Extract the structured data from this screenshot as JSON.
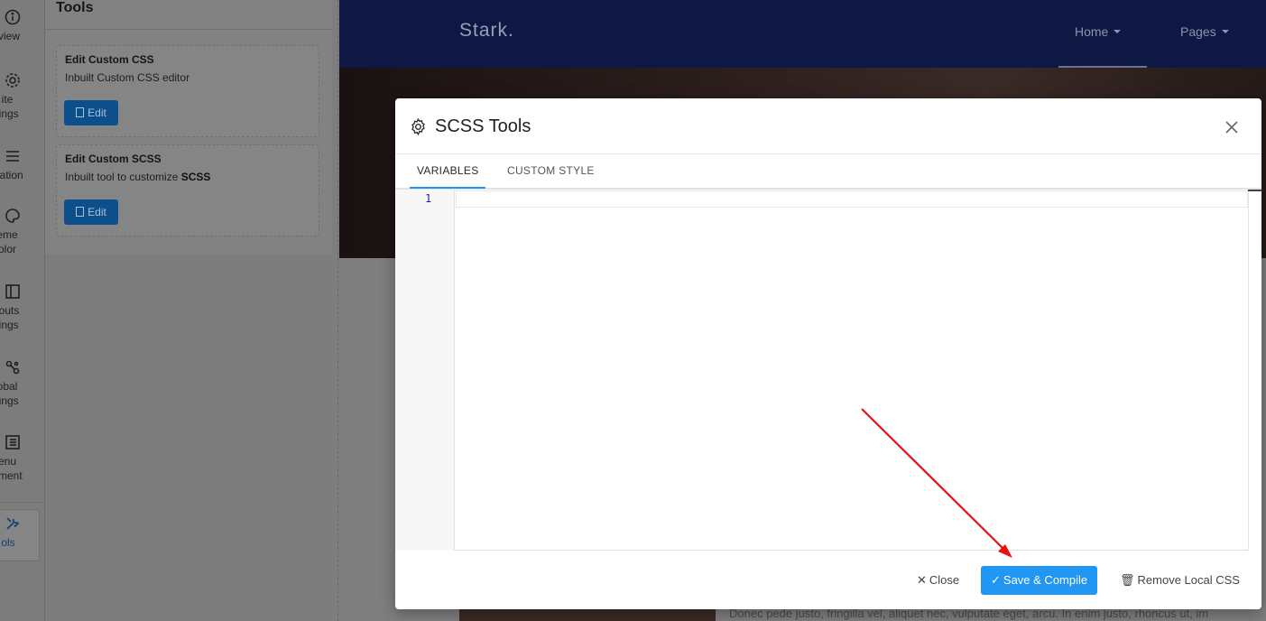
{
  "rail": {
    "items": [
      {
        "label": "Overview",
        "shown": "rview",
        "icon": "info-icon"
      },
      {
        "label": "Site Settings",
        "shown": "ite\ntings",
        "icon": "gear-icon"
      },
      {
        "label": "Navigation",
        "shown": "igation",
        "icon": "menu-icon"
      },
      {
        "label": "Theme Color",
        "shown": "eme\nolor",
        "icon": "palette-icon"
      },
      {
        "label": "Layouts Settings",
        "shown": "routs\ntings",
        "icon": "layout-icon"
      },
      {
        "label": "Global Settings",
        "shown": "obal\ntings",
        "icon": "settings-icon"
      },
      {
        "label": "Menu Assignment",
        "shown": "enu\nnment",
        "icon": "list-icon"
      },
      {
        "label": "Tools",
        "shown": "ols",
        "icon": "tools-icon"
      }
    ]
  },
  "panel": {
    "title": "Tools",
    "cards": [
      {
        "title": "Edit Custom CSS",
        "desc": "Inbuilt Custom CSS editor",
        "desc_bold": "",
        "button": "Edit"
      },
      {
        "title": "Edit Custom SCSS",
        "desc": "Inbuilt tool to customize ",
        "desc_bold": "SCSS",
        "button": "Edit"
      }
    ]
  },
  "site": {
    "logo": "Stark.",
    "nav": [
      "Home",
      "Pages"
    ],
    "paragraph": "Donec pede justo, fringilla vel, aliquet nec, vulputate eget, arcu. In enim justo, rhoncus ut, im"
  },
  "modal": {
    "title": "SCSS Tools",
    "tabs": [
      "VARIABLES",
      "CUSTOM STYLE"
    ],
    "active_tab": "VARIABLES",
    "editor": {
      "line_numbers": [
        "1"
      ],
      "content": ""
    },
    "footer": {
      "close": "Close",
      "save": "Save & Compile",
      "remove": "Remove Local CSS"
    }
  },
  "colors": {
    "primary": "#2196f3",
    "header": "#0f1745",
    "annotation_arrow": "#e81010"
  }
}
